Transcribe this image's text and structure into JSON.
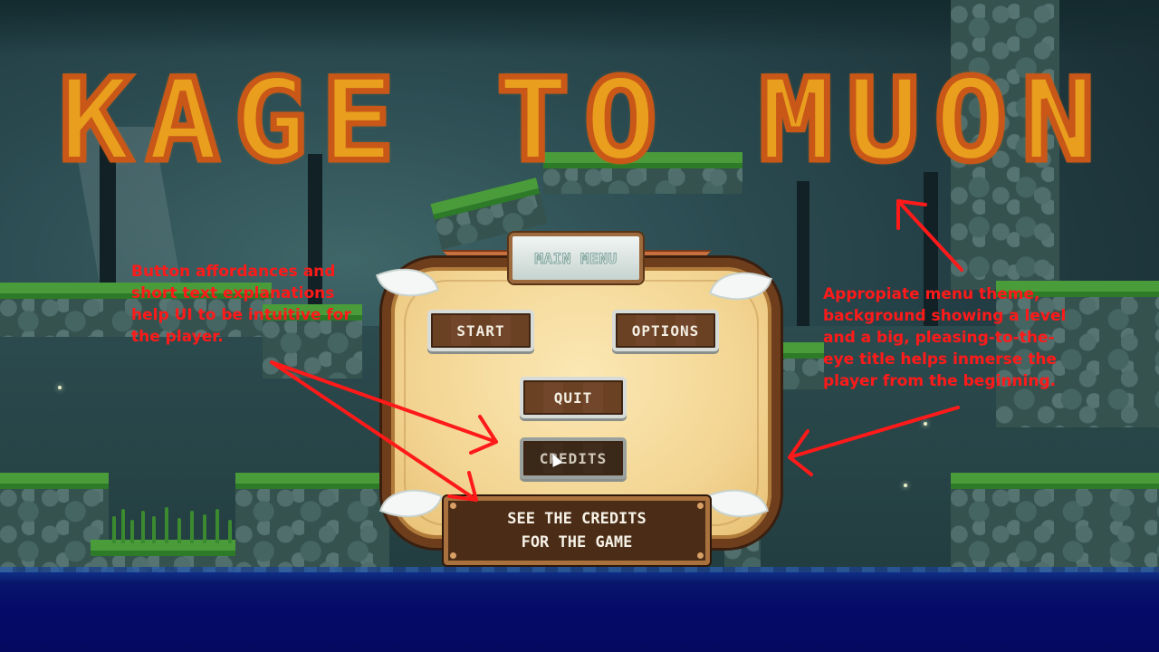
{
  "game": {
    "title": "KAGE TO MUON"
  },
  "main_menu": {
    "header": "MAIN MENU",
    "buttons": [
      {
        "label": "START"
      },
      {
        "label": "OPTIONS"
      },
      {
        "label": "QUIT"
      },
      {
        "label": "CREDITS",
        "selected": true
      }
    ],
    "tooltip_lines": [
      "SEE THE CREDITS",
      "FOR THE GAME"
    ]
  },
  "annotations": {
    "left_note_lines": [
      "Button affordances and",
      "short text explanations",
      "help UI to be intuitive for",
      "the player."
    ],
    "right_note_lines": [
      "Appropiate menu theme,",
      "background showing a level",
      "and a big, pleasing-to-the-",
      "eye title helps inmerse the",
      "player from the beginning."
    ],
    "color": "#ff1a1a"
  },
  "colors": {
    "title_fill": "#e09a19",
    "title_outline": "#c85718",
    "panel_bg": "#f3d593",
    "button_wood": "#6b4124",
    "water": "#050a69",
    "grass": "#4a9b3a"
  },
  "icons": [
    "mouse-cursor-icon",
    "leaf-corner-icon"
  ]
}
